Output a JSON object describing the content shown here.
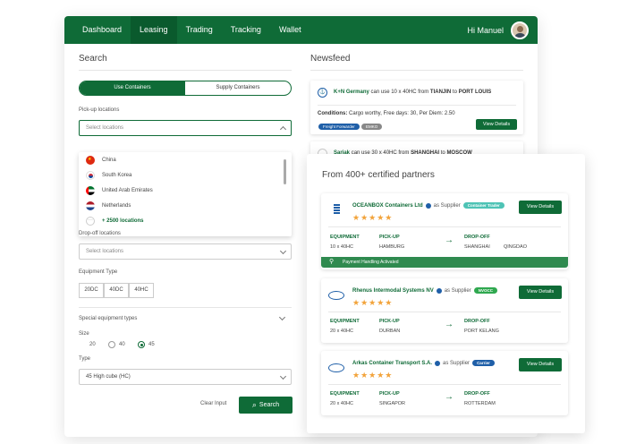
{
  "nav": {
    "items": [
      "Dashboard",
      "Leasing",
      "Trading",
      "Tracking",
      "Wallet"
    ],
    "active": "Leasing",
    "user": "Hi Manuel"
  },
  "search": {
    "title": "Search",
    "toggle": {
      "left": "Use Containers",
      "right": "Supply Containers"
    },
    "pickup_label": "Pick-up locations",
    "pickup_placeholder": "Select locations",
    "options": [
      "China",
      "South Korea",
      "United Arab Emirates",
      "Netherlands",
      "+ 2500 locations"
    ],
    "dropoff_label": "Drop-off locations",
    "dropoff_placeholder": "Select locations",
    "equipment_label": "Equipment Type",
    "equipment": [
      "20DC",
      "40DC",
      "40HC"
    ],
    "special_label": "Special equipment types",
    "size_label": "Size",
    "sizes": [
      "20",
      "40",
      "45"
    ],
    "type_label": "Type",
    "type_value": "45 High cube (HC)",
    "clear": "Clear Input",
    "search_btn": "Search"
  },
  "newsfeed": {
    "title": "Newsfeed",
    "card1": {
      "company": "K+N Germany",
      "text": "can use 10 x 40HC from",
      "from": "TIANJIN",
      "to_word": "to",
      "to": "PORT LOUIS",
      "conditions_label": "Conditions:",
      "conditions": "Cargo worthy, Free days: 30, Per Diem: 2.50",
      "tag1": "Freight Forwarder",
      "tag2": "EMKO",
      "btn": "View Details"
    },
    "card2": {
      "company": "Sariak",
      "text": "can use 30 x 40HC from",
      "from": "SHANGHAI",
      "to_word": "to",
      "to": "MOSCOW"
    }
  },
  "partners": {
    "title": "From 400+ certified partners",
    "labels": {
      "equipment": "EQUIPMENT",
      "pickup": "PICK-UP",
      "dropoff": "DROP-OFF",
      "as_supplier": "as Supplier",
      "view": "View Details"
    },
    "cards": [
      {
        "name": "OCEANBOX Containers Ltd",
        "badge": "Container Trader",
        "equipment": "10 x 40HC",
        "pickup": "HAMBURG",
        "dropoff": [
          "SHANGHAI",
          "QINGDAO"
        ],
        "payment": "Payment Handling Activated",
        "rating": 4.5
      },
      {
        "name": "Rhenus Intermodal Systems NV",
        "badge": "NVOCC",
        "equipment": "20 x 40HC",
        "pickup": "DURBAN",
        "dropoff": [
          "PORT KELANG"
        ],
        "rating": 4.5
      },
      {
        "name": "Arkas Container Transport S.A.",
        "badge": "Carrier",
        "equipment": "20 x 40HC",
        "pickup": "SINGAPOR",
        "dropoff": [
          "ROTTERDAM"
        ],
        "rating": 5
      }
    ]
  },
  "colors": {
    "brand": "#0f6b37",
    "badge_trader": "#4ec3b5",
    "badge_nvocc": "#2fa84f",
    "badge_carrier": "#1f5fa8",
    "star": "#f2a33a"
  }
}
